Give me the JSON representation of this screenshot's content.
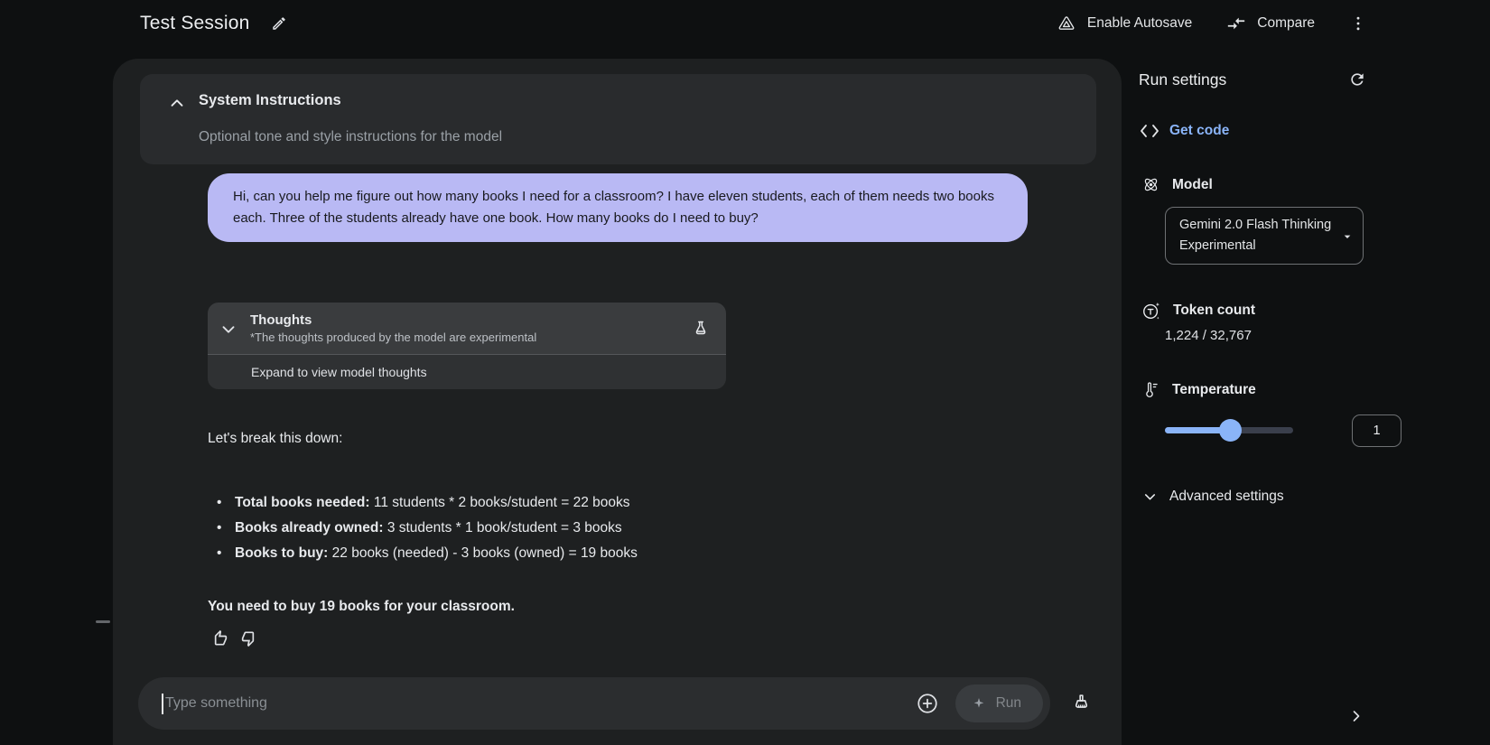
{
  "header": {
    "title": "Test Session",
    "enable_autosave": "Enable Autosave",
    "compare": "Compare"
  },
  "system_instructions": {
    "title": "System Instructions",
    "subtitle": "Optional tone and style instructions for the model"
  },
  "chat": {
    "user_message": "Hi, can you help me figure out how many books I need for a classroom? I have eleven students, each of them needs two books each. Three of the students already have one book. How many books do I need to buy?",
    "thoughts": {
      "title": "Thoughts",
      "disclaimer": "*The thoughts produced by the model are experimental",
      "expand_label": "Expand to view model thoughts"
    },
    "response": {
      "intro": "Let's break this down:",
      "bullets": [
        {
          "bold": "Total books needed:",
          "rest": " 11 students * 2 books/student = 22 books"
        },
        {
          "bold": "Books already owned:",
          "rest": " 3 students * 1 book/student = 3 books"
        },
        {
          "bold": "Books to buy:",
          "rest": " 22 books (needed) - 3 books (owned) = 19 books"
        }
      ],
      "conclusion": "You need to buy 19 books for your classroom."
    }
  },
  "composer": {
    "placeholder": "Type something",
    "run_label": "Run"
  },
  "run_settings": {
    "title": "Run settings",
    "get_code": "Get code",
    "model": {
      "label": "Model",
      "selected": "Gemini 2.0 Flash Thinking Experimental"
    },
    "token_count": {
      "label": "Token count",
      "value": "1,224 / 32,767"
    },
    "temperature": {
      "label": "Temperature",
      "value": "1"
    },
    "advanced": "Advanced settings"
  },
  "icons": {
    "edit": "pencil",
    "enable_autosave": "triangle-in-triangle",
    "compare": "compare-arrows",
    "more": "kebab-menu",
    "system_collapse": "chevron-up",
    "thoughts_expand": "chevron-down",
    "experimental": "lab-flask",
    "feedback_positive": "thumb-up",
    "feedback_negative": "thumb-down",
    "attach": "plus-circle",
    "run": "sparkle",
    "clear": "broom",
    "reset_settings": "refresh",
    "get_code": "code-brackets",
    "model": "atom-orbits",
    "token_count": "circled-t-sparkle",
    "temperature": "thermometer",
    "dropdown": "triangle-down",
    "panel_collapse": "chevron-right"
  },
  "colors": {
    "accent_blue": "#8ab4f8",
    "user_bubble": "#b9b9f4",
    "panel_bg": "#1e2021",
    "page_bg": "#0e1011",
    "disabled_text": "#82868a"
  }
}
